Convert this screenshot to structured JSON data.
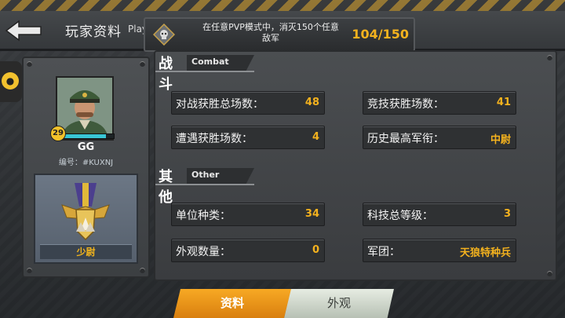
{
  "header": {
    "title": "玩家资料",
    "title_sub": "Play",
    "mission_text": "在任意PVP模式中，消灭150个任意敌军",
    "mission_progress": "104/150"
  },
  "player": {
    "level": "29",
    "name": "GG",
    "id_text": "编号：#KUXNJ",
    "rank": "少尉",
    "xp_fraction": 0.85
  },
  "combat": {
    "title_cn": "战斗",
    "title_en": "Combat",
    "stats": [
      {
        "label": "对战获胜总场数：",
        "value": "48"
      },
      {
        "label": "竞技获胜场数：",
        "value": "41"
      },
      {
        "label": "遭遇获胜场数：",
        "value": "4"
      },
      {
        "label": "历史最高军衔：",
        "value": "中尉"
      }
    ]
  },
  "other": {
    "title_cn": "其他",
    "title_en": "Other",
    "stats": [
      {
        "label": "单位种类：",
        "value": "34"
      },
      {
        "label": "科技总等级：",
        "value": "3"
      },
      {
        "label": "外观数量：",
        "value": "0"
      },
      {
        "label": "军团：",
        "value": "天狼特种兵"
      }
    ]
  },
  "tabs": [
    {
      "label": "资料",
      "active": true
    },
    {
      "label": "外观",
      "active": false
    }
  ],
  "colors": {
    "accent": "#f4b21e",
    "active_tab": "#f7a924",
    "xp": "#39c6d4"
  }
}
